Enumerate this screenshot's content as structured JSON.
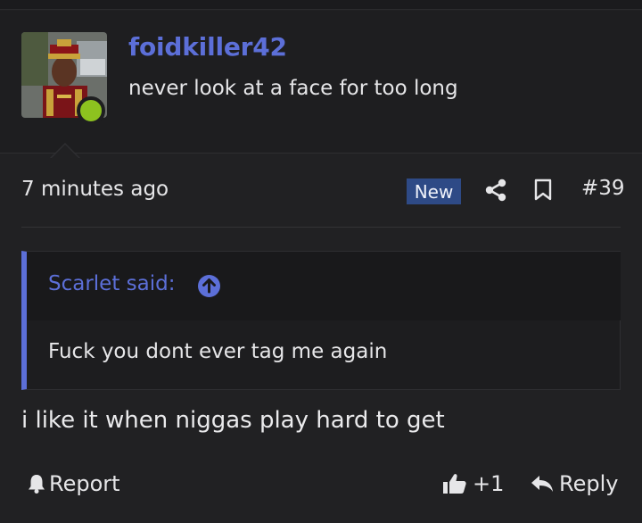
{
  "post": {
    "username": "foidkiller42",
    "user_title": "never look at a face for too long",
    "timestamp": "7 minutes ago",
    "badge": "New",
    "post_number": "#39",
    "body": "i like it when niggas play hard to get"
  },
  "quote": {
    "author": "Scarlet said:",
    "text": "Fuck you dont ever tag me again"
  },
  "actions": {
    "report_label": "Report",
    "like_label": "+1",
    "reply_label": "Reply"
  },
  "icons": {
    "share": "share-icon",
    "bookmark": "bookmark-icon",
    "quote_jump": "arrow-up-circle-icon",
    "report": "bell-icon",
    "like": "thumbs-up-icon",
    "reply": "reply-arrow-icon"
  },
  "colors": {
    "accent": "#5c6fd8",
    "online": "#8dc21f",
    "badge_bg": "#2e4a86",
    "background": "#212123"
  }
}
